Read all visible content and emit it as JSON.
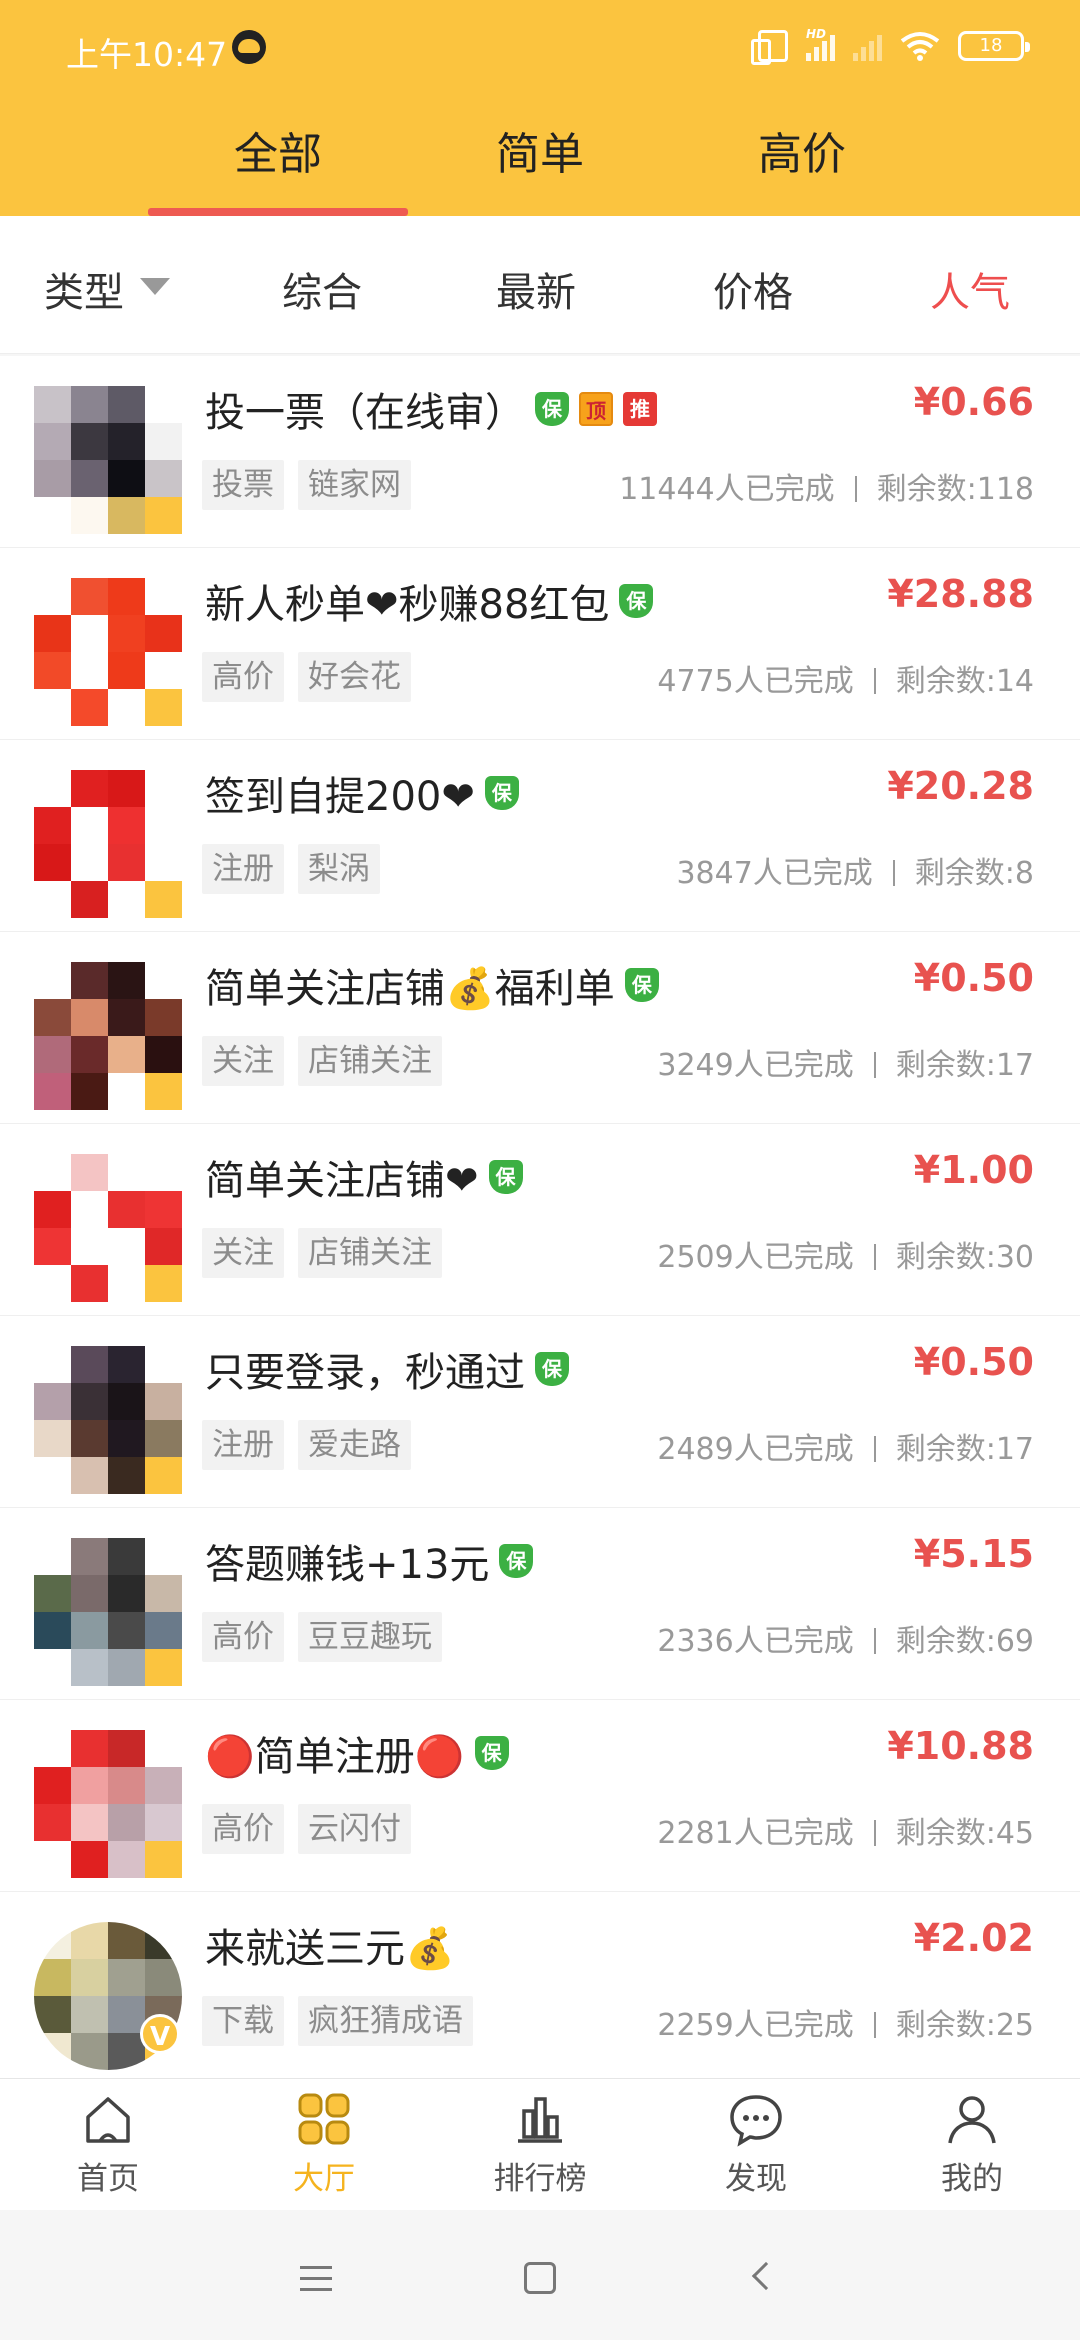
{
  "status_bar": {
    "time": "上午10:47",
    "battery": "18",
    "network_label": "HD"
  },
  "tabs": [
    {
      "label": "全部",
      "active": true
    },
    {
      "label": "简单",
      "active": false
    },
    {
      "label": "高价",
      "active": false
    }
  ],
  "filter": {
    "type_label": "类型",
    "items": [
      {
        "label": "综合",
        "active": false
      },
      {
        "label": "最新",
        "active": false
      },
      {
        "label": "价格",
        "active": false
      },
      {
        "label": "人气",
        "active": true
      }
    ]
  },
  "tasks": [
    {
      "title": "投一票（在线审）",
      "badges": [
        "保",
        "顶",
        "推"
      ],
      "price": "¥0.66",
      "tags": [
        "投票",
        "链家网"
      ],
      "completed": "11444人已完成",
      "remaining": "剩余数:118",
      "avatar_colors": [
        "#c8c2c8",
        "#8a8490",
        "#5e5a66",
        "#ffffff",
        "#b4aab4",
        "#3c3840",
        "#24222a",
        "#f2f2f2",
        "#a89ca6",
        "#6a6270",
        "#0e0e14",
        "#c9c4c8",
        "#ffffff",
        "#fdf8f0",
        "#d8b860",
        "#fbc43f"
      ]
    },
    {
      "title": "新人秒单❤秒赚88红包",
      "badges": [
        "保"
      ],
      "price": "¥28.88",
      "tags": [
        "高价",
        "好会花"
      ],
      "completed": "4775人已完成",
      "remaining": "剩余数:14",
      "avatar_colors": [
        "#ffffff",
        "#f05030",
        "#ee3a1a",
        "#ffffff",
        "#e83418",
        "#ffffff",
        "#f04020",
        "#e8321a",
        "#f24a28",
        "#ffffff",
        "#ee3a1a",
        "#ffffff",
        "#ffffff",
        "#f44a2a",
        "#ffffff",
        "#fbc43f"
      ]
    },
    {
      "title": "签到自提200❤",
      "badges": [
        "保"
      ],
      "price": "¥20.28",
      "tags": [
        "注册",
        "梨涡"
      ],
      "completed": "3847人已完成",
      "remaining": "剩余数:8",
      "avatar_colors": [
        "#ffffff",
        "#e02020",
        "#d81818",
        "#ffffff",
        "#e02020",
        "#ffffff",
        "#ee3030",
        "#ffffff",
        "#d81818",
        "#ffffff",
        "#e83030",
        "#ffffff",
        "#ffffff",
        "#d82020",
        "#ffffff",
        "#fbc43f"
      ]
    },
    {
      "title": "简单关注店铺💰福利单",
      "badges": [
        "保"
      ],
      "price": "¥0.50",
      "tags": [
        "关注",
        "店铺关注"
      ],
      "completed": "3249人已完成",
      "remaining": "剩余数:17",
      "avatar_colors": [
        "#ffffff",
        "#5a2a2a",
        "#2a1414",
        "#ffffff",
        "#8a4a3a",
        "#d88a6a",
        "#3a1a1a",
        "#7a3a2a",
        "#b06a7a",
        "#6a2a2a",
        "#e8b08a",
        "#2a1010",
        "#c0607a",
        "#4a1a14",
        "#ffffff",
        "#fbc43f"
      ]
    },
    {
      "title": "简单关注店铺❤",
      "badges": [
        "保"
      ],
      "price": "¥1.00",
      "tags": [
        "关注",
        "店铺关注"
      ],
      "completed": "2509人已完成",
      "remaining": "剩余数:30",
      "avatar_colors": [
        "#ffffff",
        "#f4c4c4",
        "#ffffff",
        "#ffffff",
        "#e02020",
        "#ffffff",
        "#e83030",
        "#ee3434",
        "#ee3434",
        "#ffffff",
        "#ffffff",
        "#e02828",
        "#ffffff",
        "#e83030",
        "#ffffff",
        "#fbc43f"
      ]
    },
    {
      "title": "只要登录，秒通过",
      "badges": [
        "保"
      ],
      "price": "¥0.50",
      "tags": [
        "注册",
        "爱走路"
      ],
      "completed": "2489人已完成",
      "remaining": "剩余数:17",
      "avatar_colors": [
        "#ffffff",
        "#5a4a5a",
        "#2a2430",
        "#ffffff",
        "#b4a0aa",
        "#3a3036",
        "#1a1418",
        "#c8b0a0",
        "#e8d8c8",
        "#5a3a30",
        "#201820",
        "#8a7a60",
        "#ffffff",
        "#d8c0b0",
        "#3a2a20",
        "#fbc43f"
      ]
    },
    {
      "title": "答题赚钱+13元",
      "badges": [
        "保"
      ],
      "price": "¥5.15",
      "tags": [
        "高价",
        "豆豆趣玩"
      ],
      "completed": "2336人已完成",
      "remaining": "剩余数:69",
      "avatar_colors": [
        "#ffffff",
        "#8a7a7a",
        "#3a3a3a",
        "#ffffff",
        "#5a6a4a",
        "#7a6a6a",
        "#2a2a2a",
        "#c8b8a8",
        "#2a4a5a",
        "#8a9aa0",
        "#4a4a4a",
        "#6a7a8a",
        "#ffffff",
        "#b8c0c8",
        "#a0a8b0",
        "#fbc43f"
      ]
    },
    {
      "title": "🔴简单注册🔴",
      "badges": [
        "保"
      ],
      "price": "¥10.88",
      "tags": [
        "高价",
        "云闪付"
      ],
      "completed": "2281人已完成",
      "remaining": "剩余数:45",
      "avatar_colors": [
        "#ffffff",
        "#e83030",
        "#c82828",
        "#ffffff",
        "#e02020",
        "#f0a0a0",
        "#d88a8a",
        "#c8b0b8",
        "#e83030",
        "#f4c4c4",
        "#b8a0a8",
        "#d8c8d0",
        "#ffffff",
        "#e02020",
        "#d8c0c8",
        "#fbc43f"
      ]
    },
    {
      "title": "来就送三元💰",
      "badges": [],
      "price": "¥2.02",
      "tags": [
        "下载",
        "疯狂猜成语"
      ],
      "completed": "2259人已完成",
      "remaining": "剩余数:25",
      "avatar_colors": [
        "#f4f0e0",
        "#e8d8a8",
        "#6a5a3a",
        "#3a3a2a",
        "#c8b860",
        "#d8d0a0",
        "#a0a090",
        "#8a8a7a",
        "#5a5a3a",
        "#c0c0b0",
        "#8a9098",
        "#7a6a5a",
        "#f0e8d0",
        "#9a9a8a",
        "#5a5a5a",
        "#fbc43f"
      ],
      "round": true,
      "v_badge": "V"
    }
  ],
  "bottom_nav": [
    {
      "label": "首页",
      "icon": "home-icon",
      "active": false
    },
    {
      "label": "大厅",
      "icon": "grid-icon",
      "active": true
    },
    {
      "label": "排行榜",
      "icon": "ranking-icon",
      "active": false
    },
    {
      "label": "发现",
      "icon": "chat-bubble-icon",
      "active": false
    },
    {
      "label": "我的",
      "icon": "user-icon",
      "active": false
    }
  ],
  "colors": {
    "header_yellow": "#fbc43f",
    "accent_red": "#ee4e4e",
    "price_red": "#e8524f",
    "nav_active": "#f5b31e",
    "guarantee_green": "#3cb043"
  }
}
